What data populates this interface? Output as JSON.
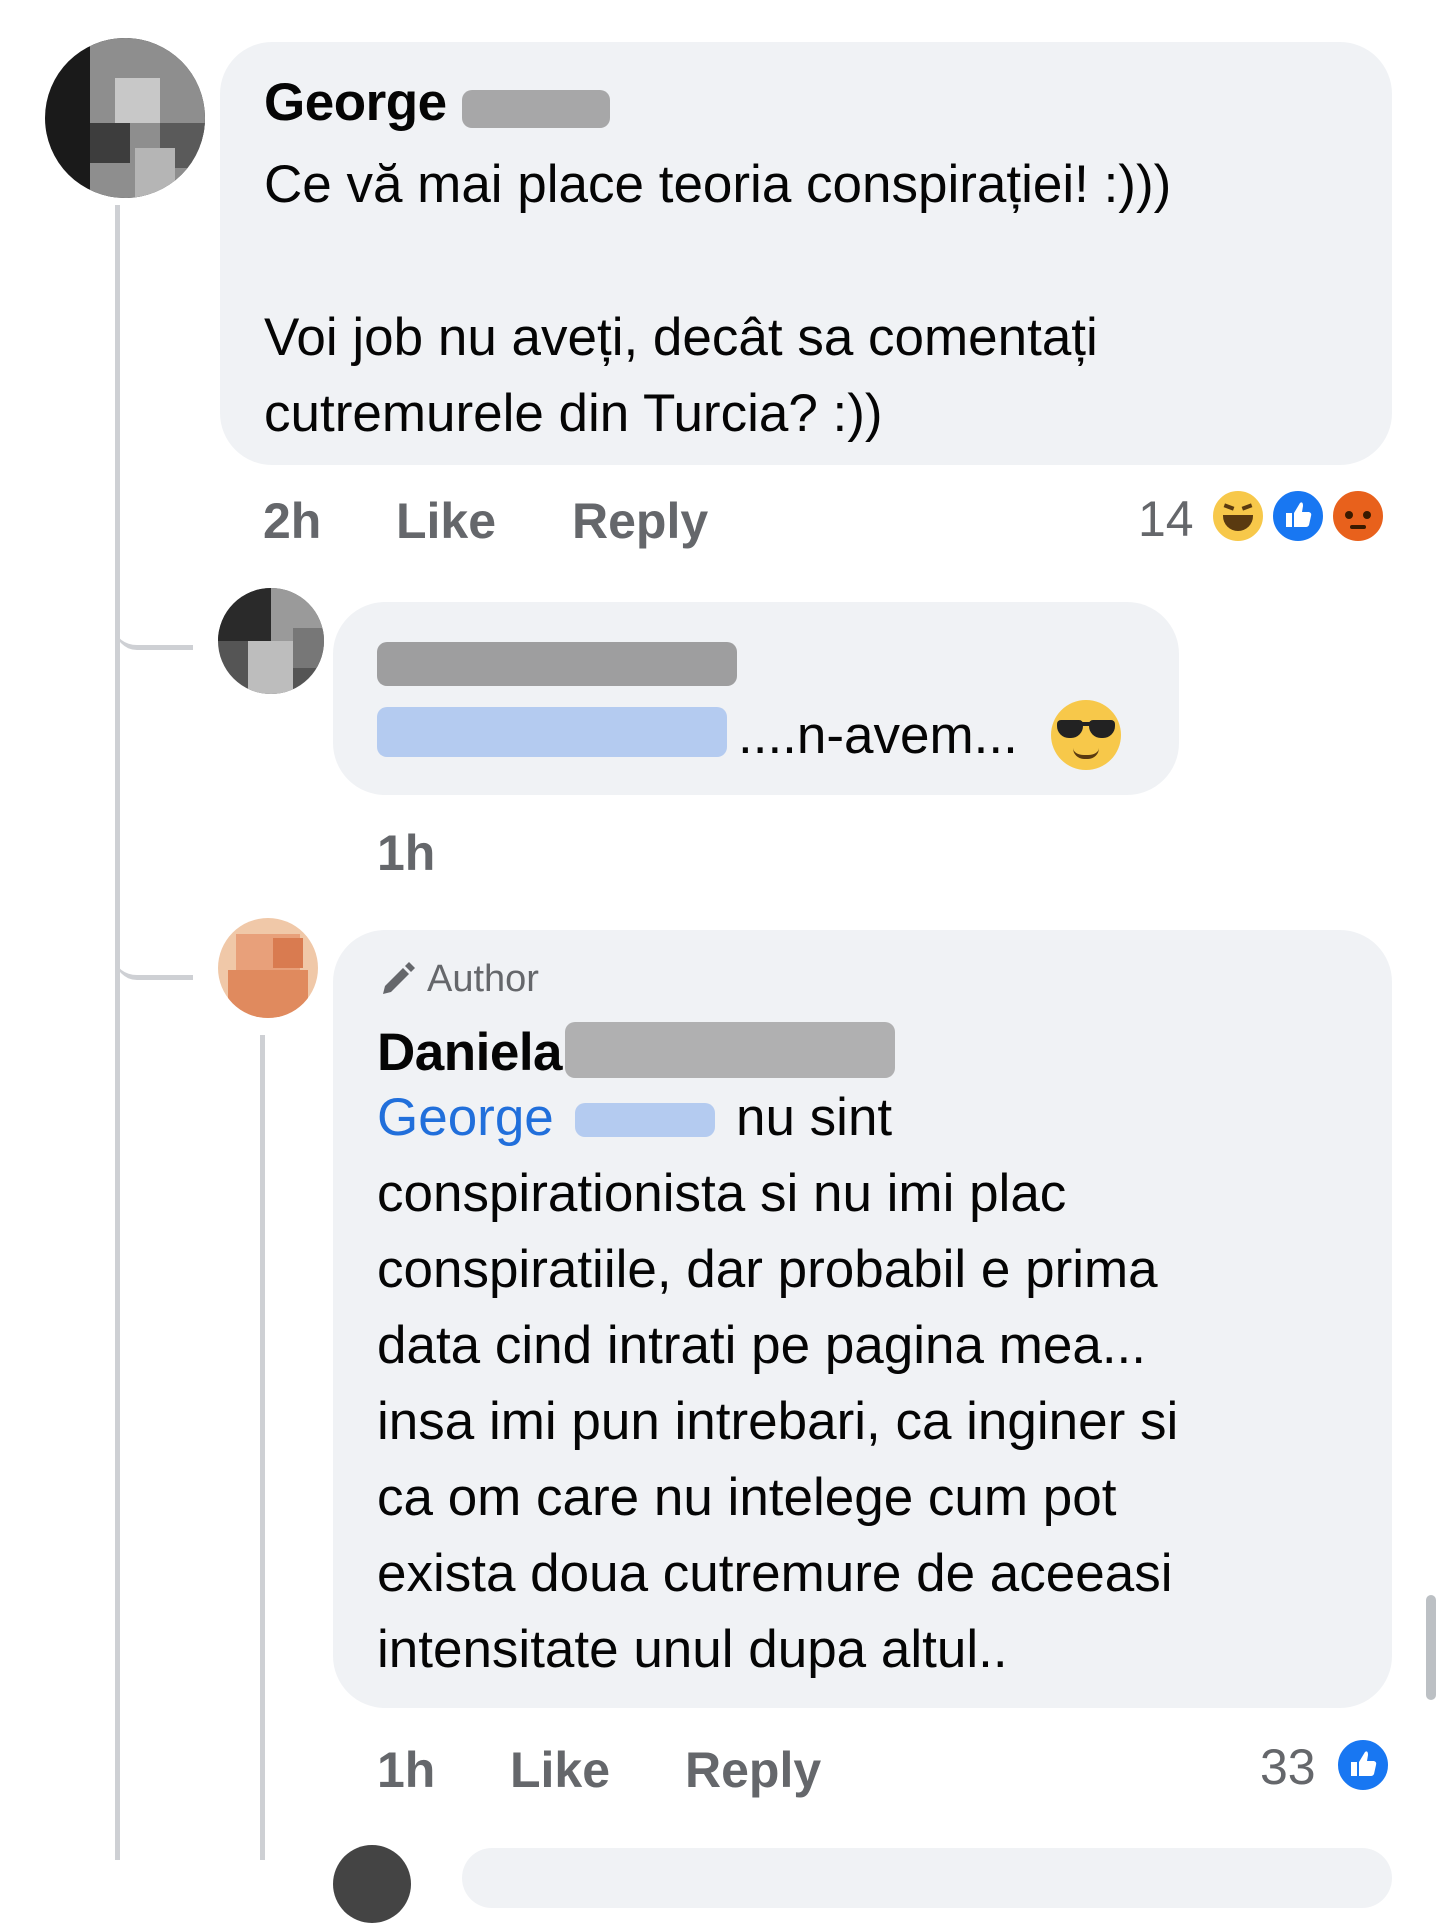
{
  "comment": {
    "author_first_name": "George",
    "text_line1": "Ce vă mai place teoria conspirației! :)))",
    "text_line2": "Voi job nu aveți, decât sa comentați",
    "text_line3": "cutremurele din Turcia? :))",
    "time": "2h",
    "like_label": "Like",
    "reply_label": "Reply",
    "reaction_count": "14",
    "reactions": [
      "haha-icon",
      "like-icon",
      "angry-icon"
    ]
  },
  "reply1": {
    "text": "....n-avem...",
    "emoji": "sunglasses-emoji",
    "time": "1h"
  },
  "reply2": {
    "badge": "Author",
    "author_first_name": "Daniela",
    "mention": "George",
    "line1": "nu sint",
    "line2": "conspirationista si nu imi plac",
    "line3": "conspiratiile, dar probabil e prima",
    "line4": "data cind intrati pe pagina mea...",
    "line5": "insa imi pun intrebari, ca inginer si",
    "line6": "ca om care nu intelege cum pot",
    "line7": "exista doua cutremure de aceeasi",
    "line8": "intensitate unul dupa altul..",
    "time": "1h",
    "like_label": "Like",
    "reply_label": "Reply",
    "reaction_count": "33",
    "reactions": [
      "like-icon"
    ]
  },
  "colors": {
    "bubble": "#f0f2f5",
    "meta_text": "#65676b",
    "mention": "#216fdb",
    "like_blue": "#1877f2"
  }
}
